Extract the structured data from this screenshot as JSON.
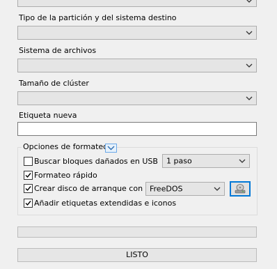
{
  "top_combo": {
    "value": ""
  },
  "partition": {
    "label": "Tipo de la partición y del sistema destino",
    "value": ""
  },
  "filesystem": {
    "label": "Sistema de archivos",
    "value": ""
  },
  "cluster": {
    "label": "Tamaño de clúster",
    "value": ""
  },
  "volume_label": {
    "label": "Etiqueta nueva",
    "value": ""
  },
  "format_options": {
    "title": "Opciones de formateo",
    "bad_blocks": {
      "label": "Buscar bloques dañados en USB",
      "checked": false,
      "passes": "1 paso"
    },
    "quick_format": {
      "label": "Formateo rápido",
      "checked": true
    },
    "bootable": {
      "label": "Crear disco de arranque con",
      "checked": true,
      "type": "FreeDOS"
    },
    "extended_labels": {
      "label": "Añadir etiquetas extendidas e iconos",
      "checked": true
    }
  },
  "progress": {
    "value": 0
  },
  "status": {
    "text": "LISTO"
  },
  "colors": {
    "accent": "#0078d7",
    "window_bg": "#f0f0f0"
  }
}
